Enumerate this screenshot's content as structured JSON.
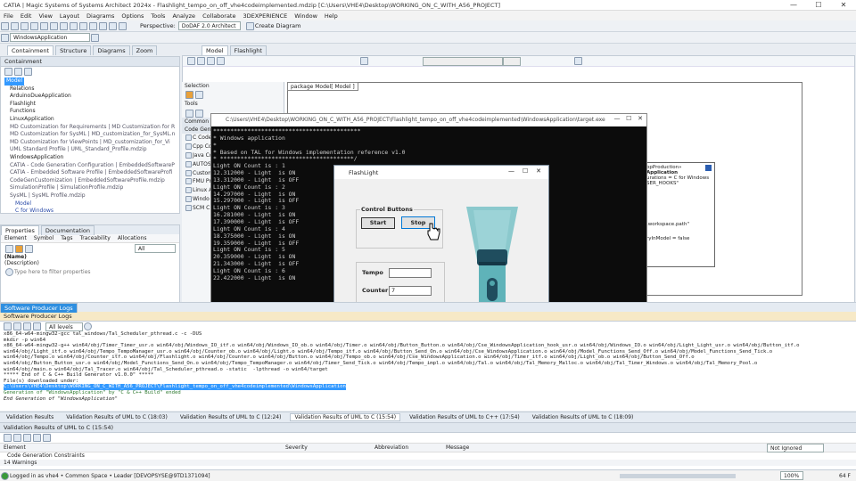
{
  "window": {
    "title": "CATIA | Magic Systems of Systems Architect 2024x - Flashlight_tempo_on_off_vhe4codeimplemented.mdzip [C:\\Users\\VHE4\\Desktop\\WORKING_ON_C_WITH_A56_PROJECT]",
    "minimize": "—",
    "maximize": "☐",
    "close": "✕"
  },
  "menu": [
    "File",
    "Edit",
    "View",
    "Layout",
    "Diagrams",
    "Options",
    "Tools",
    "Analyze",
    "Collaborate",
    "3DEXPERIENCE",
    "Window",
    "Help"
  ],
  "toolbar": {
    "perspective_label": "Perspective:",
    "perspective_value": "DoDAF 2.0 Architect",
    "create_diagram": "Create Diagram"
  },
  "toolbar2": {
    "scope_value": "WindowsApplication",
    "tabs": [
      "Containment",
      "Structure",
      "Diagrams",
      "Zoom"
    ]
  },
  "diagram_tabs": [
    "Model",
    "Flashlight"
  ],
  "containment": {
    "header": "Containment",
    "items": [
      {
        "label": "Model",
        "selected": true
      },
      {
        "label": "Relations"
      },
      {
        "label": "ArduinoDueApplication"
      },
      {
        "label": "Flashlight"
      },
      {
        "label": "Functions"
      },
      {
        "label": "LinuxApplication"
      },
      {
        "label": "MD Customization for Requirements | MD Customization for R"
      },
      {
        "label": "MD Customization for SysML | MD_customization_for_SysML.n"
      },
      {
        "label": "MD Customization for ViewPoints | MD_customization_for_Vi"
      },
      {
        "label": "UML Standard Profile | UML_Standard_Profile.mdzip"
      },
      {
        "label": "WindowsApplication"
      },
      {
        "label": "CATIA - Code Generation Configuration | EmbeddedSoftwareP"
      },
      {
        "label": "CATIA - Embedded Software Profile | EmbeddedSoftwareProfi"
      },
      {
        "label": "CodeGenCustomization | EmbeddedSoftwareProfile.mdzip"
      },
      {
        "label": "SimulationProfile | SimulationProfile.mdzip"
      },
      {
        "label": "SysML | SysML Profile.mdzip"
      },
      {
        "label": "Model"
      },
      {
        "label": "C for Windows"
      }
    ]
  },
  "properties": {
    "tabs": [
      "Properties",
      "Documentation"
    ],
    "subtabs": [
      "Element",
      "Symbol",
      "Tags",
      "Traceability",
      "Allocations"
    ],
    "filter_value": "All",
    "name_label": "(Name)",
    "desc_label": "(Description)",
    "filter_placeholder": "Type here to filter properties"
  },
  "palette": {
    "selection": "Selection",
    "tools": "Tools",
    "common": "Common",
    "code_gen": "Code Gener",
    "items": [
      "C Code",
      "Cpp Code",
      "Java Code",
      "AUTOSAR",
      "Custom",
      "FMU Pr",
      "Linux A",
      "Windo",
      "SCM C"
    ]
  },
  "diagram": {
    "tab_label": "package  Model[  Model ]",
    "side_text": [
      "opProduction»",
      "Application",
      "urations = C for Windows",
      "SER_HOOKS\"",
      ".workspace.path\"",
      "ryInModel = false"
    ]
  },
  "console": {
    "title": "C:\\Users\\VHE4\\Desktop\\WORKING_ON_C_WITH_A56_PROJECT\\Flashlight_tempo_on_off_vhe4codeimplemented\\WindowsApplication\\target.exe",
    "lines": [
      "*******************************************",
      "* Windows application",
      "*",
      "* Based on TAL for Windows implementation reference v1.0",
      "* ***************************************/",
      "Light ON Count is : 1",
      "12.312000 - Light  is ON",
      "13.312000 - Light  is OFF",
      "Light ON Count is : 2",
      "14.297000 - Light  is ON",
      "15.297000 - Light  is OFF",
      "Light ON Count is : 3",
      "16.281000 - Light  is ON",
      "17.390000 - Light  is OFF",
      "Light ON Count is : 4",
      "18.375000 - Light  is ON",
      "19.359000 - Light  is OFF",
      "Light ON Count is : 5",
      "20.359000 - Light  is ON",
      "21.343000 - Light  is OFF",
      "Light ON Count is : 6",
      "22.422000 - Light  is ON"
    ]
  },
  "flashlight": {
    "title": "FlashLight",
    "group_label": "Control Buttons",
    "start": "Start",
    "stop": "Stop",
    "tempo_label": "Tempo",
    "tempo_value": "",
    "counter_label": "Counter:",
    "counter_value": "7"
  },
  "log": {
    "tab": "Software Producer Logs",
    "header": "Software Producer Logs",
    "level": "All levels",
    "lines": [
      "x86_64-w64-mingw32-gcc tal_windows/Tal_Scheduler_pthread.c -c -DUS",
      "mkdir -p win64",
      "x86_64-w64-mingw32-g++ win64/obj/Timer_Timer_usr.o win64/obj/Windows_IO_itf.o win64/obj/Windows_IO_ob.o win64/obj/Timer.o win64/obj/Button_Button.o win64/obj/Cse_WindowsApplication_hook_usr.o win64/obj/Windows_IO.o win64/obj/Light_Light_usr.o win64/obj/Button_itf.o",
      "win64/obj/Light_itf.o win64/obj/Tempo_TempoManager_usr.o win64/obj/Counter_ob.o win64/obj/Light.o win64/obj/Tempo_itf.o win64/obj/Button_Send_On.o win64/obj/Cse_WindowsApplication.o win64/obj/Model_Functions_Send_Off.o win64/obj/Model_Functions_Send_Tick.o",
      "win64/obj/Tempo.o win64/obj/Counter_itf.o win64/obj/Flashlight.o win64/obj/Counter.o win64/obj/Button.o win64/obj/Tempo_ob.o win64/obj/Cse_WindowsApplication.o win64/obj/Timer_itf.o win64/obj/Light_ob.o win64/obj/Button_Send_Off.o",
      "win64/obj/Button_Button_usr.o win64/obj/Model_Functions_Send_On.o win64/obj/Tempo_TempoManager.o win64/obj/Timer_Send_Tick.o win64/obj/Tempo_impl.o win64/obj/Tal.o win64/obj/Tal_Memory_Malloc.o win64/obj/Tal_Timer_Windows.o win64/obj/Tal_Memory_Pool.o",
      "win64/obj/main.o win64/obj/Tal_Tracer.o win64/obj/Tal_Scheduler_pthread.o -static  -lpthread -o win64/target",
      "***** End of C & C++ Build Generator v1.0.0\" *****",
      "File(s) downloaded under:",
      "C:\\Users\\VHE4\\Desktop\\WORKING_ON_C_WITH_A56_PROJECT\\Flashlight_tempo_on_off_vhe4codeimplemented\\WindowsApplication",
      "Generation of \"WindowsApplication\" by \"C & C++ Build\" ended",
      "End Generation of \"WindowsApplication\""
    ]
  },
  "bottom_tabs": [
    "Validation Results",
    "Validation Results of UML to C (18:03)",
    "Validation Results of UML to C (12:24)",
    "Validation Results of UML to C (15:54)",
    "Validation Results of UML to C++ (17:54)",
    "Validation Results of UML to C (18:09)"
  ],
  "validation": {
    "header": "Validation Results of UML to C (15:54)",
    "columns": [
      "Element",
      "Severity",
      "Abbreviation",
      "Message"
    ],
    "filter": "Not Ignored",
    "row": "Code Generation Constraints",
    "count": "14 Warnings"
  },
  "status": {
    "login": "Logged in as vhe4 • Common Space • Leader [DEVOPSYSE@9TD1371094]",
    "zoom": "100%",
    "temp": "64 F"
  },
  "colors": {
    "accent": "#3399ff",
    "console_bg": "#0c0c0c",
    "flashlight": "#79c2c7",
    "flashlight_dark": "#1f4d5e"
  }
}
